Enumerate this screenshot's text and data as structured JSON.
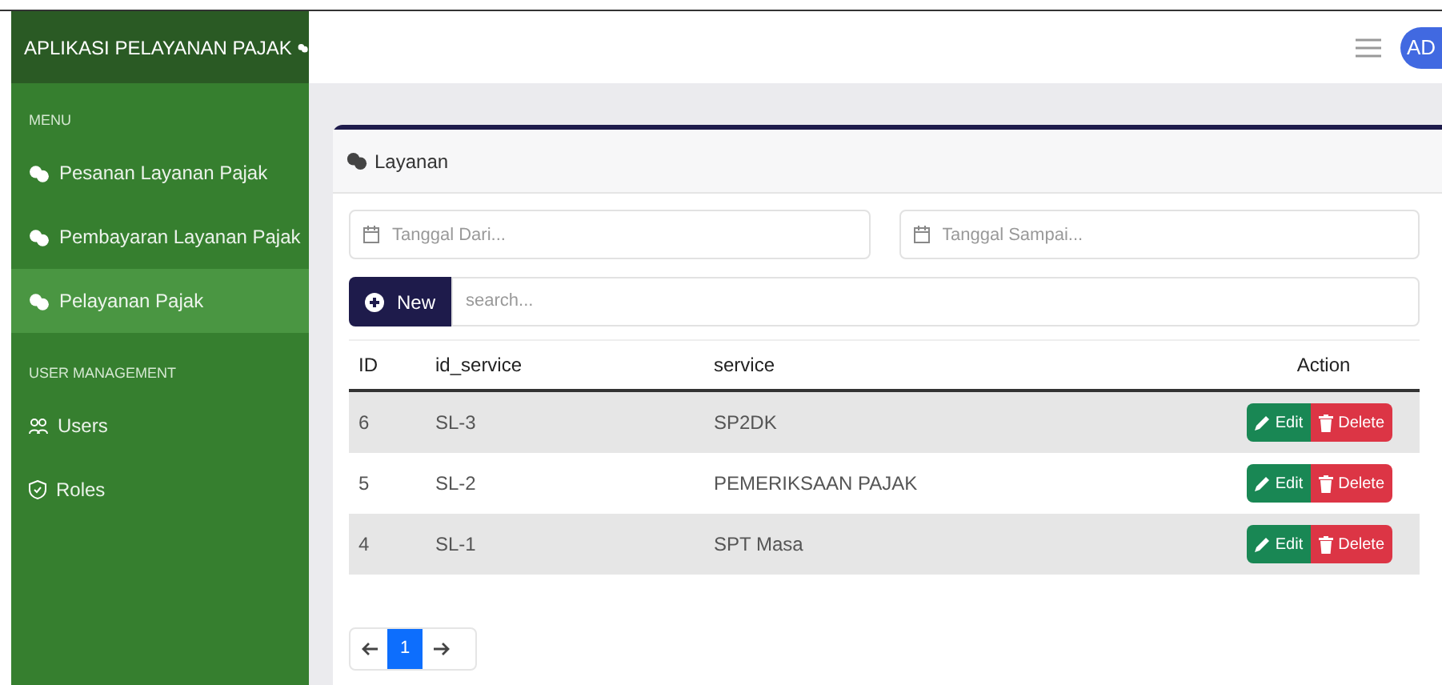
{
  "app_title": "APLIKASI PELAYANAN PAJAK",
  "avatar": "AD",
  "sidebar": {
    "sections": [
      {
        "heading": "MENU",
        "items": [
          {
            "label": "Pesanan Layanan Pajak",
            "selected": false
          },
          {
            "label": "Pembayaran Layanan Pajak",
            "selected": false
          },
          {
            "label": "Pelayanan Pajak",
            "selected": true
          }
        ]
      },
      {
        "heading": "USER MANAGEMENT",
        "items": [
          {
            "label": "Users",
            "selected": false
          },
          {
            "label": "Roles",
            "selected": false
          }
        ]
      }
    ]
  },
  "card": {
    "title": "Layanan",
    "date_from": {
      "placeholder": "Tanggal Dari..."
    },
    "date_to": {
      "placeholder": "Tanggal Sampai..."
    },
    "new_button": "New",
    "search": {
      "placeholder": "search..."
    },
    "table": {
      "columns": [
        "ID",
        "id_service",
        "service",
        "Action"
      ],
      "rows": [
        {
          "cells": [
            "6",
            "SL-3",
            "SP2DK"
          ],
          "actions": [
            "Edit",
            "Delete"
          ]
        },
        {
          "cells": [
            "5",
            "SL-2",
            "PEMERIKSAAN PAJAK"
          ],
          "actions": [
            "Edit",
            "Delete"
          ]
        },
        {
          "cells": [
            "4",
            "SL-1",
            "SPT Masa"
          ],
          "actions": [
            "Edit",
            "Delete"
          ]
        }
      ]
    },
    "pagination": {
      "pages": [
        {
          "label": "1",
          "selected": true
        }
      ]
    }
  }
}
